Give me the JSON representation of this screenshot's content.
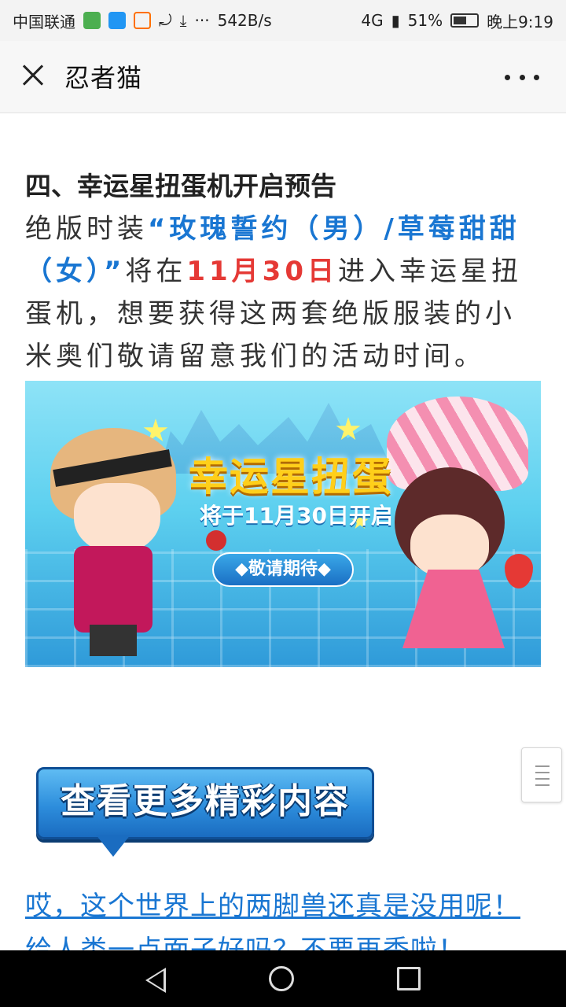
{
  "status_bar": {
    "carrier": "中国联通",
    "icons": [
      "app-icon-green",
      "app-icon-blue",
      "app-icon-100",
      "missed-call-icon",
      "download-icon"
    ],
    "dots": "···",
    "speed": "542B/s",
    "signal": "4G",
    "battery": "51%",
    "time": "晚上9:19"
  },
  "nav": {
    "title": "忍者猫"
  },
  "article": {
    "heading": "四、幸运星扭蛋机开启预告",
    "p1": "绝版时装",
    "p2_blue": "“玫瑰誓约（男）/草莓甜甜（女）”",
    "p3": "将在",
    "p4_red": "11月30日",
    "p5": "进入幸运星扭蛋机，想要获得这两套绝版服装的小米奥们敬请留意我们的活动时间。"
  },
  "banner": {
    "title": "幸运星扭蛋",
    "subtitle": "将于11月30日开启",
    "tagline": "◆敬请期待◆"
  },
  "more_button": {
    "label": "查看更多精彩内容"
  },
  "links": [
    "哎，这个世界上的两脚兽还真是没用呢！",
    "给人类一点面子好吗？不要再秀啦！"
  ],
  "colors": {
    "link": "#1976d2",
    "highlight_red": "#e53935",
    "button_blue": "#2d8ddc"
  }
}
